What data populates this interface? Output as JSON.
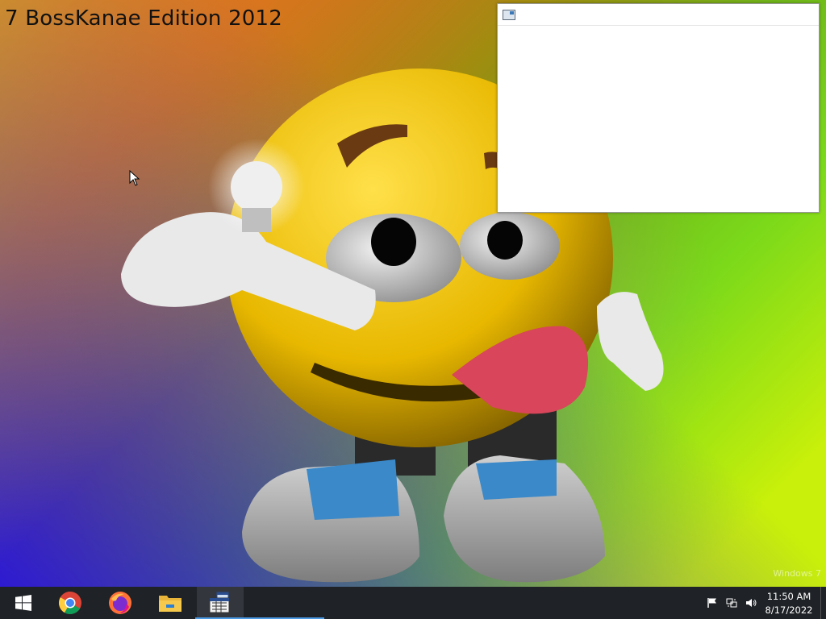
{
  "desktop": {
    "wallpaper_title": "7 BossKanae Edition 2012",
    "watermark": "Windows 7",
    "colors": {
      "red": "#e0103a",
      "green": "#7bd91a",
      "blue": "#2814dc",
      "yellow": "#e6f000"
    }
  },
  "window": {
    "icon": "window-app-icon"
  },
  "taskbar": {
    "items": [
      {
        "name": "start-button",
        "icon": "windows-logo-icon"
      },
      {
        "name": "chrome-button",
        "icon": "chrome-icon"
      },
      {
        "name": "firefox-button",
        "icon": "firefox-icon"
      },
      {
        "name": "file-explorer-button",
        "icon": "folder-icon"
      },
      {
        "name": "running-app-button",
        "icon": "app-window-icon"
      }
    ],
    "tray": {
      "icons": [
        "flag-icon",
        "network-icon",
        "volume-icon"
      ],
      "time": "11:50 AM",
      "date": "8/17/2022"
    }
  }
}
